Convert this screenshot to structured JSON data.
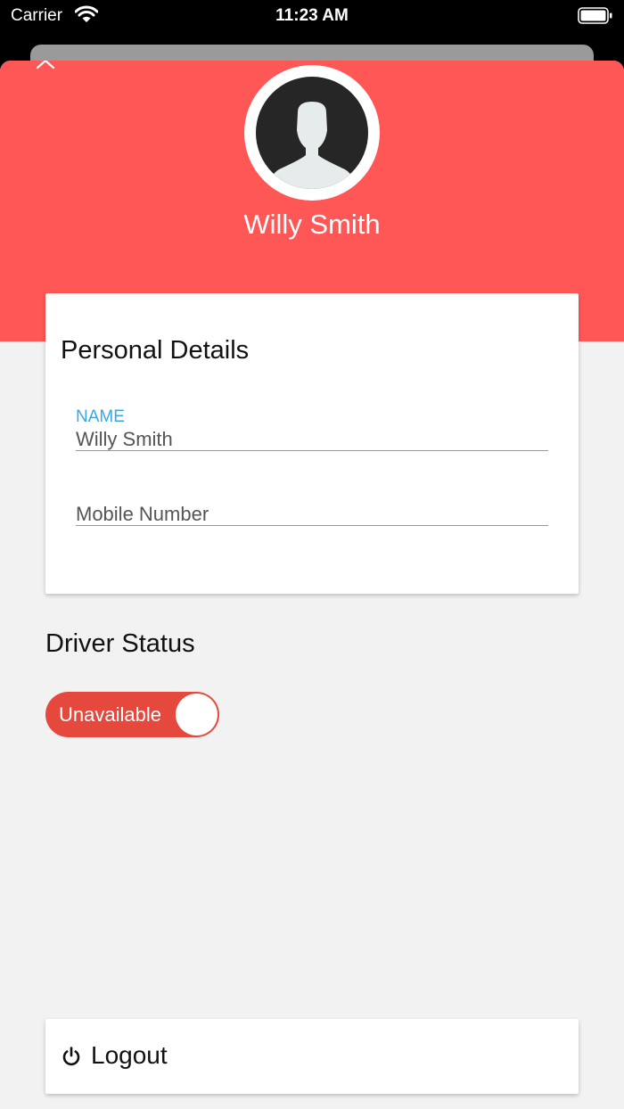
{
  "status_bar": {
    "carrier": "Carrier",
    "time": "11:23 AM"
  },
  "profile": {
    "name": "Willy Smith"
  },
  "personal_details": {
    "title": "Personal Details",
    "name_field": {
      "label": "NAME",
      "value": "Willy Smith"
    },
    "mobile_field": {
      "placeholder": "Mobile Number",
      "value": ""
    }
  },
  "driver_status": {
    "title": "Driver Status",
    "toggle_label": "Unavailable",
    "available": false
  },
  "logout": {
    "label": "Logout"
  },
  "colors": {
    "header": "#ff5656",
    "toggle_off": "#e5483c",
    "field_label": "#3ba7e2",
    "background": "#f2f2f2"
  },
  "icons": [
    "wifi-icon",
    "battery-icon",
    "chevron-up-icon",
    "avatar-silhouette-icon",
    "power-icon"
  ]
}
